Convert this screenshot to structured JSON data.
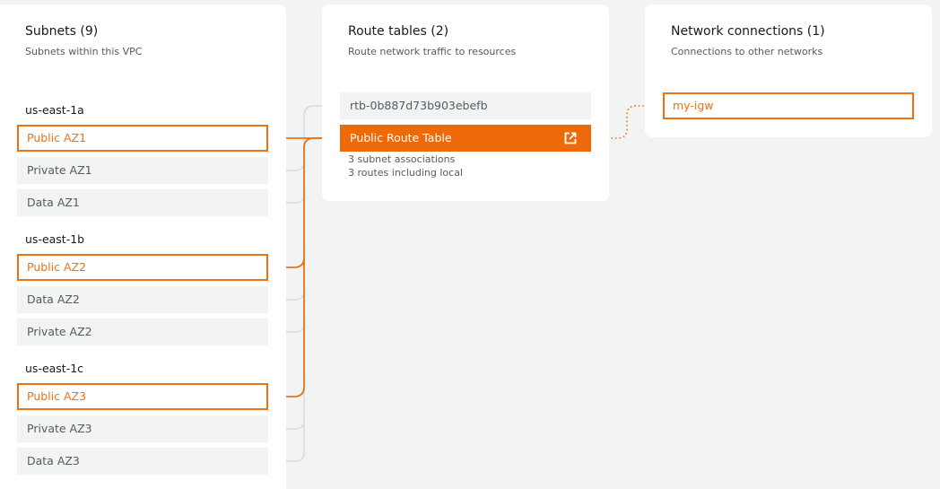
{
  "subnets": {
    "title": "Subnets (9)",
    "subtitle": "Subnets within this VPC",
    "zones": [
      {
        "label": "us-east-1a",
        "subnets": [
          {
            "name": "Public AZ1",
            "highlighted": true
          },
          {
            "name": "Private AZ1",
            "highlighted": false
          },
          {
            "name": "Data AZ1",
            "highlighted": false
          }
        ]
      },
      {
        "label": "us-east-1b",
        "subnets": [
          {
            "name": "Public AZ2",
            "highlighted": true
          },
          {
            "name": "Data AZ2",
            "highlighted": false
          },
          {
            "name": "Private AZ2",
            "highlighted": false
          }
        ]
      },
      {
        "label": "us-east-1c",
        "subnets": [
          {
            "name": "Public AZ3",
            "highlighted": true
          },
          {
            "name": "Private AZ3",
            "highlighted": false
          },
          {
            "name": "Data AZ3",
            "highlighted": false
          }
        ]
      }
    ]
  },
  "route_tables": {
    "title": "Route tables (2)",
    "subtitle": "Route network traffic to resources",
    "items": [
      {
        "name": "rtb-0b887d73b903ebefb",
        "selected": false
      },
      {
        "name": "Public Route Table",
        "selected": true,
        "associations": "3 subnet associations",
        "routes": "3 routes including local",
        "icon": "external-link-icon"
      }
    ]
  },
  "network_connections": {
    "title": "Network connections (1)",
    "subtitle": "Connections to other networks",
    "items": [
      {
        "name": "my-igw"
      }
    ]
  },
  "colors": {
    "accent": "#ec7211",
    "selected_fill": "#ec6a0a",
    "connector_inactive": "#d5dbdb",
    "background": "#f2f3f3"
  }
}
